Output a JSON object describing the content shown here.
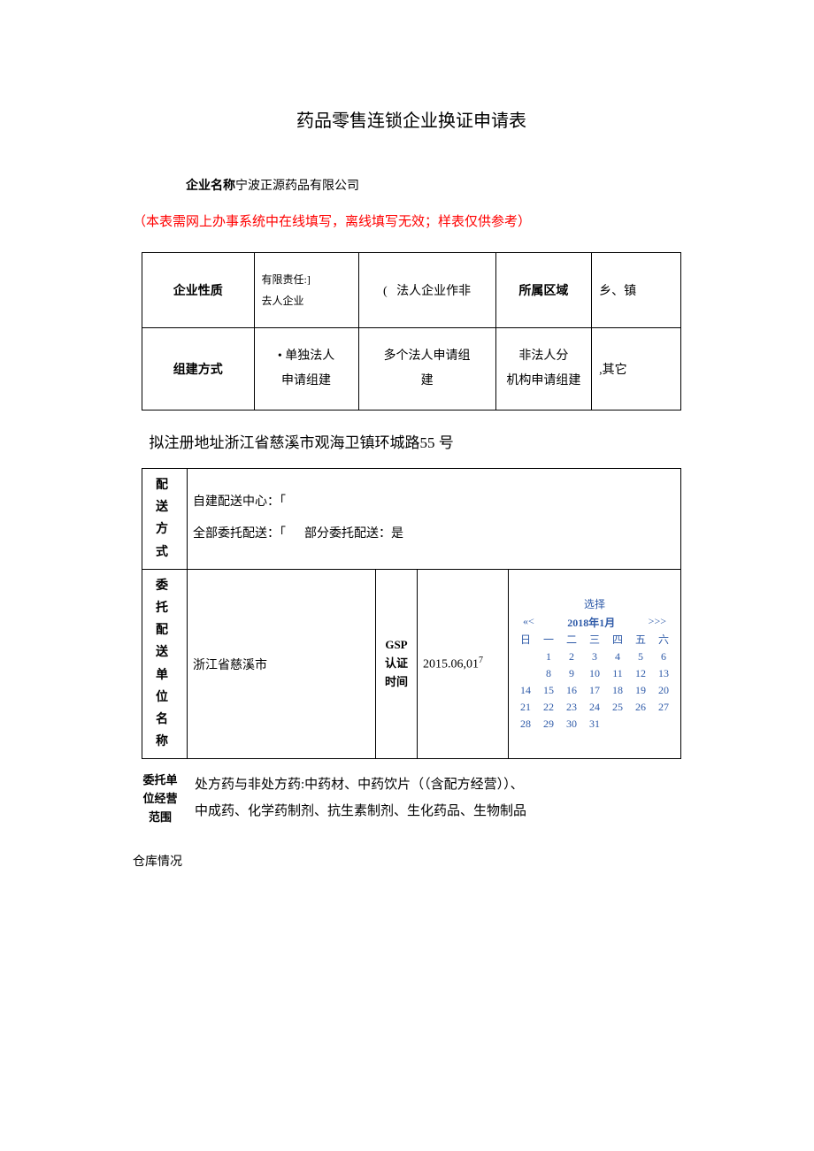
{
  "doc": {
    "title": "药品零售连锁企业换证申请表",
    "company_label": "企业名称",
    "company_name": "宁波正源药品有限公司",
    "notice": "（本表需网上办事系统中在线填写，离线填写无效；样表仅供参考）"
  },
  "table1": {
    "r1c1": "企业性质",
    "r1c2a": "有限责任:]",
    "r1c2b": "去人企业",
    "r1c3_paren": "(",
    "r1c3": "法人企业作非",
    "r1c4": "所属区域",
    "r1c5": "乡、镇",
    "r2c1": "组建方式",
    "r2c2_bullet": "•",
    "r2c2": "单独法人\n申请组建",
    "r2c3": "多个法人申请组\n建",
    "r2c4": "非法人分\n机构申请组建",
    "r2c5": ",其它"
  },
  "address": {
    "label": "拟注册地址",
    "value": "浙江省慈溪市观海卫镇环城路55 号"
  },
  "delivery": {
    "label": "配送方式",
    "line1": "自建配送中心：「",
    "line2a": "全部委托配送：「",
    "line2b": "部分委托配送：是"
  },
  "entrust": {
    "unit_label": "委托配送单位名称",
    "unit_value": "浙江省慈溪市",
    "gsp_label": "GSP认证时间",
    "gsp_value": "2015.06,01",
    "gsp_sup": "7"
  },
  "calendar": {
    "choose": "选择",
    "nav_left": "«<",
    "month": "2018年1月",
    "nav_right": ">>>",
    "dow": [
      "日",
      "一",
      "二",
      "三",
      "四",
      "五",
      "六"
    ],
    "rows": [
      [
        "",
        "1",
        "2",
        "3",
        "4",
        "5",
        "6"
      ],
      [
        "",
        "8",
        "9",
        "10",
        "11",
        "12",
        "13"
      ],
      [
        "14",
        "15",
        "16",
        "17",
        "18",
        "19",
        "20"
      ],
      [
        "21",
        "22",
        "23",
        "24",
        "25",
        "26",
        "27"
      ],
      [
        "28",
        "29",
        "30",
        "31",
        "",
        "",
        ""
      ]
    ]
  },
  "scope": {
    "label": "委托单位经营范围",
    "value_l1": " 处方药与非处方药:中药材、中药饮片（（含配方经营））、",
    "value_l2": "中成药、化学药制剂、抗生素制剂、生化药品、生物制品"
  },
  "warehouse": "仓库情况"
}
